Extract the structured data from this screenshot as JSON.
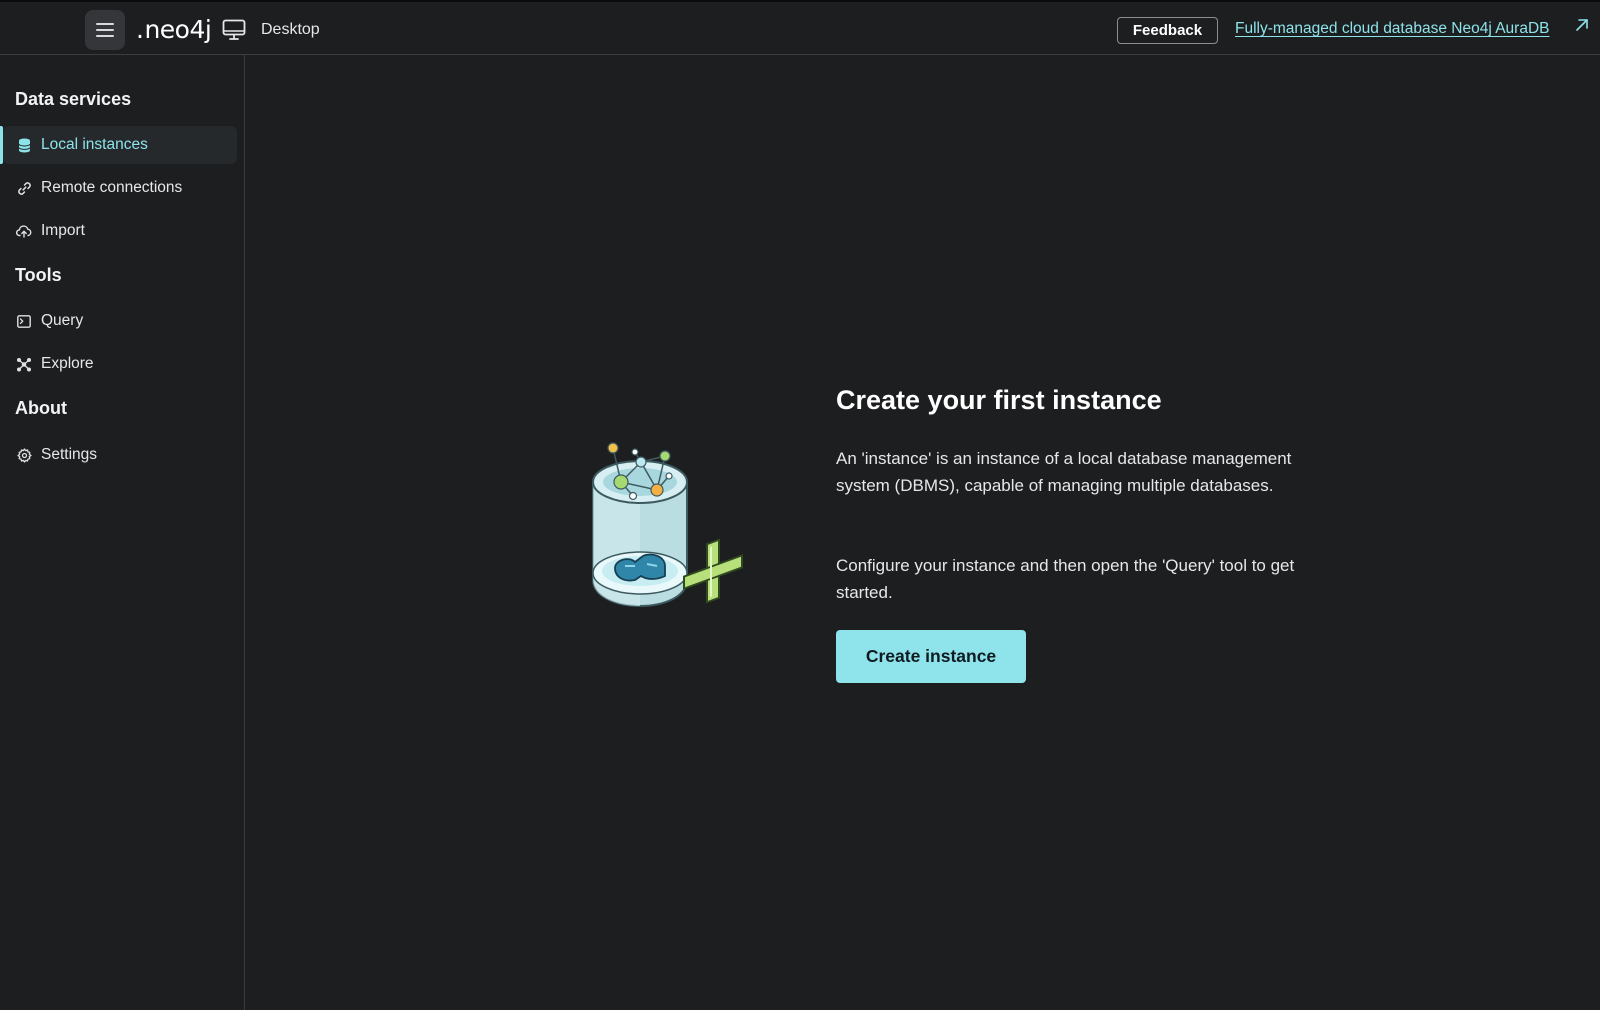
{
  "header": {
    "menu_icon": "hamburger-menu-icon",
    "logo_text": "neo4j",
    "logo_dot": ".",
    "desktop_icon": "monitor-icon",
    "product_label": "Desktop",
    "feedback_label": "Feedback",
    "aura_link_label": "Fully-managed cloud database Neo4j AuraDB",
    "external_icon": "external-link-arrow-icon"
  },
  "sidebar": {
    "sections": [
      {
        "title": "Data services",
        "items": [
          {
            "label": "Local instances",
            "icon": "database-icon",
            "active": true
          },
          {
            "label": "Remote connections",
            "icon": "link-icon",
            "active": false
          },
          {
            "label": "Import",
            "icon": "cloud-upload-icon",
            "active": false
          }
        ]
      },
      {
        "title": "Tools",
        "items": [
          {
            "label": "Query",
            "icon": "terminal-icon",
            "active": false
          },
          {
            "label": "Explore",
            "icon": "graph-nodes-icon",
            "active": false
          }
        ]
      },
      {
        "title": "About",
        "items": [
          {
            "label": "Settings",
            "icon": "gear-icon",
            "active": false
          }
        ]
      }
    ]
  },
  "main": {
    "illustration": "database-cylinder-with-graph-and-plus-illustration",
    "title": "Create your first instance",
    "paragraph1": "An 'instance' is an instance of a local database management system (DBMS), capable of managing multiple databases.",
    "paragraph2": "Configure your instance and then open the 'Query' tool to get started.",
    "create_button_label": "Create instance"
  },
  "colors": {
    "background": "#1d1e20",
    "accent": "#8de3ea",
    "button_bg": "#8fe3ea",
    "border": "#3a3c40"
  }
}
